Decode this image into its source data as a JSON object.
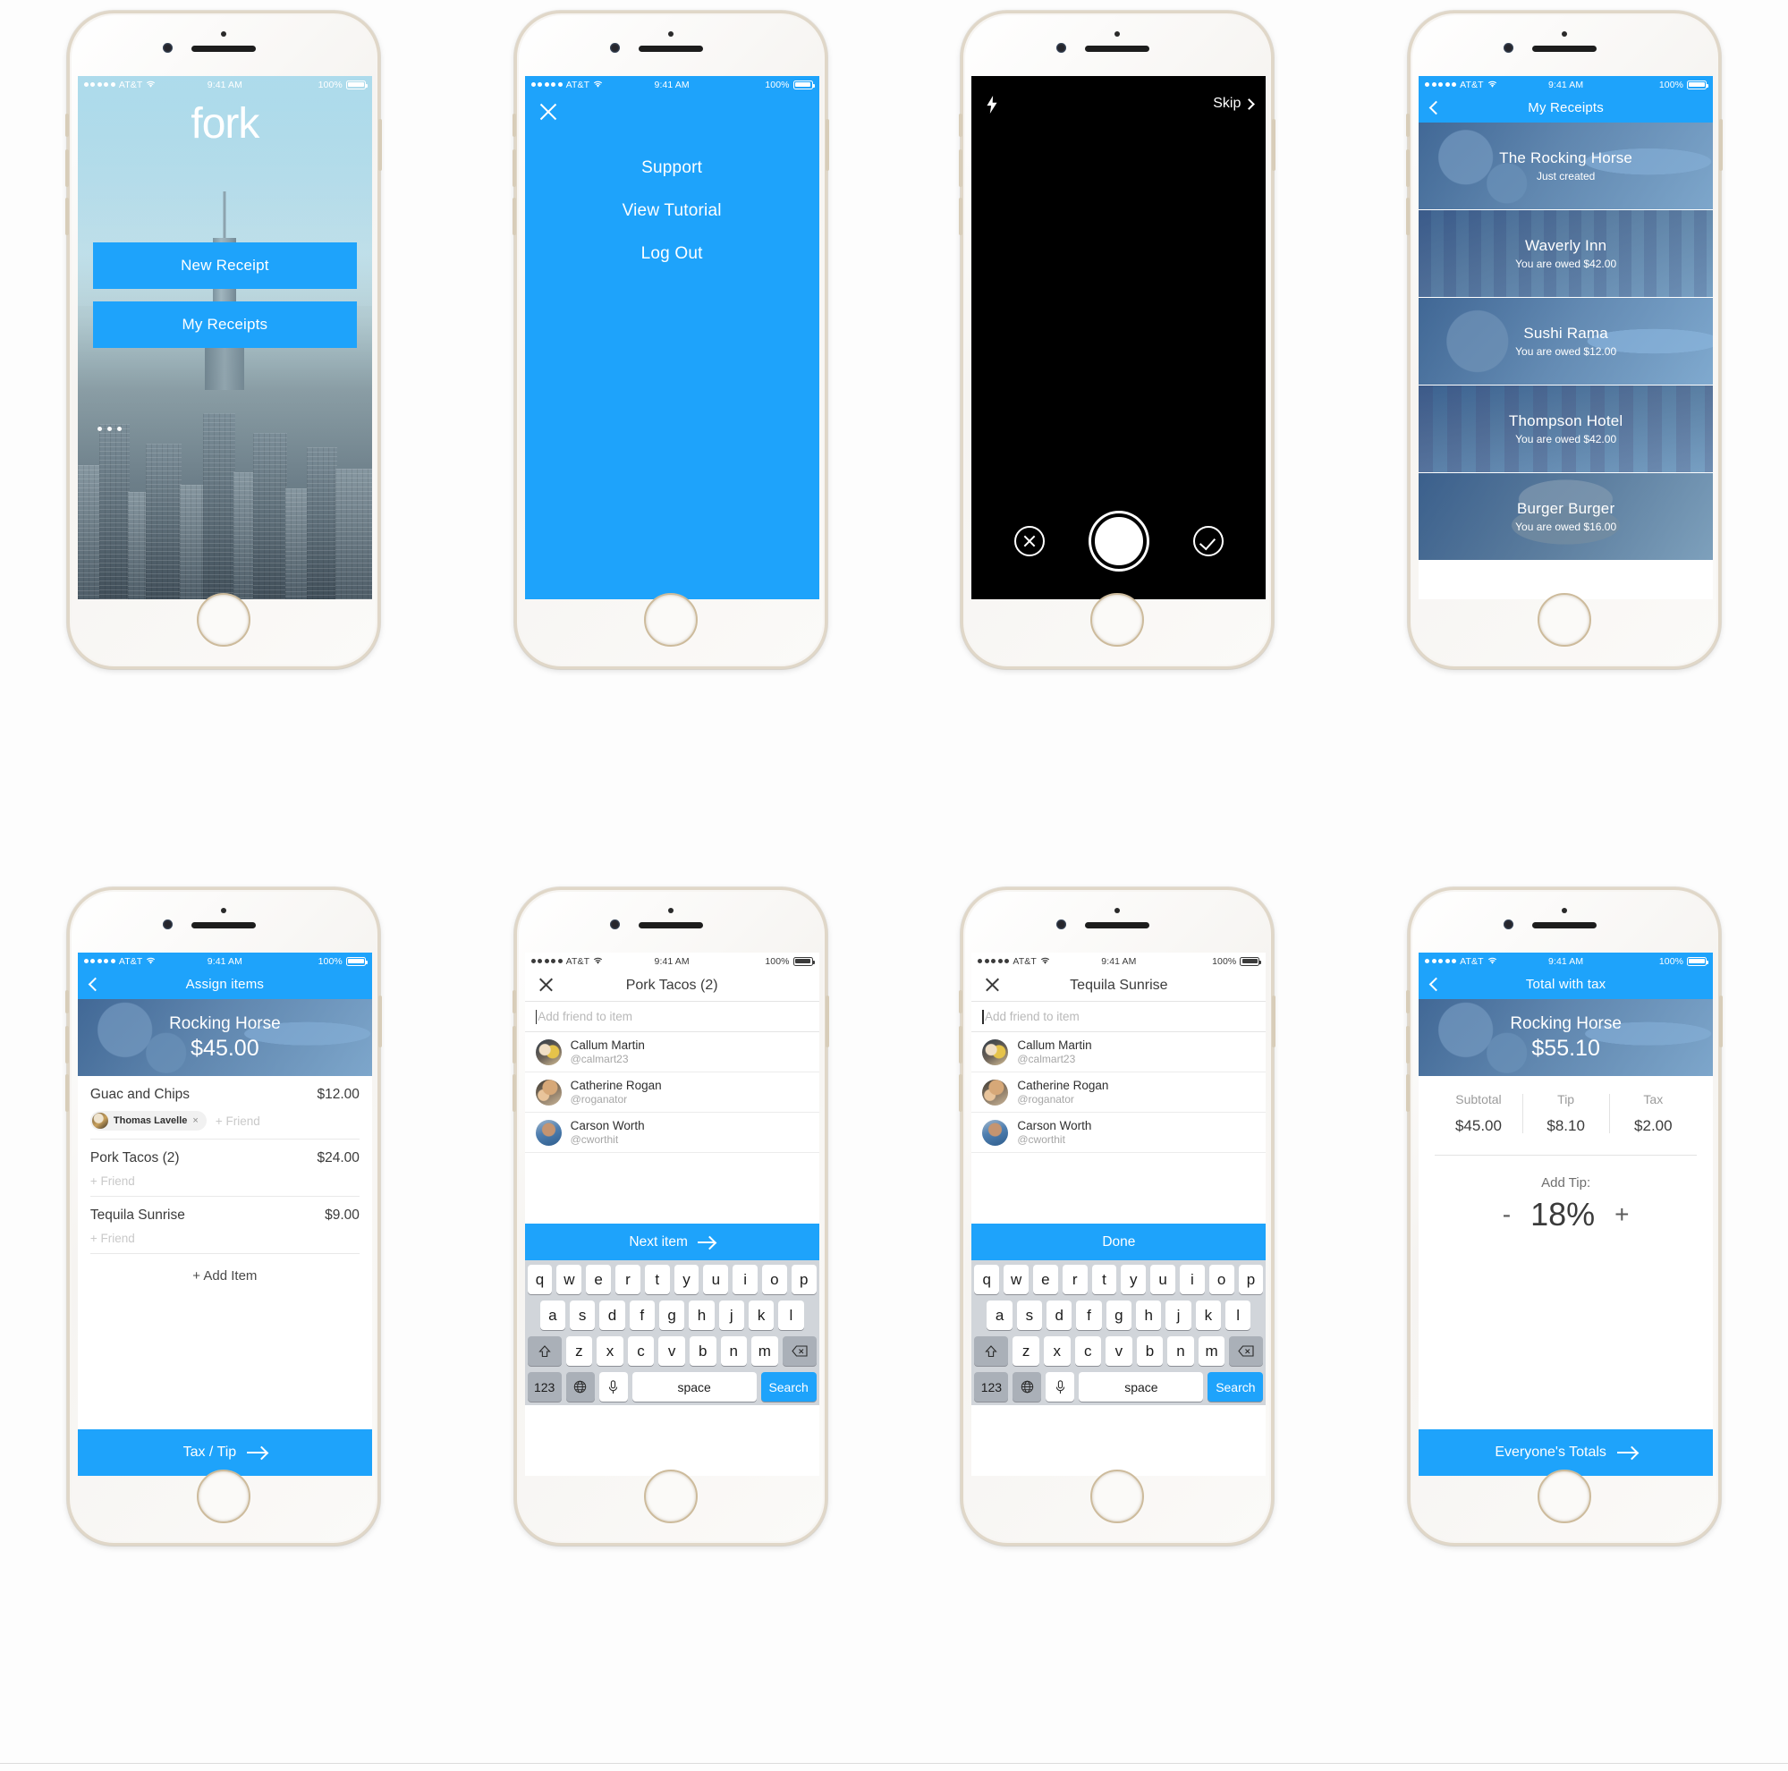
{
  "status_bar": {
    "carrier": "AT&T",
    "time": "9:41 AM",
    "battery": "100%"
  },
  "app": {
    "name": "fork"
  },
  "screens": {
    "splash": {
      "logo": "fork",
      "new_receipt_label": "New Receipt",
      "my_receipts_label": "My Receipts"
    },
    "menu": {
      "items": [
        {
          "label": "Support"
        },
        {
          "label": "View Tutorial"
        },
        {
          "label": "Log Out"
        }
      ]
    },
    "camera": {
      "skip_label": "Skip"
    },
    "receipts": {
      "title": "My Receipts",
      "rows": [
        {
          "name": "The Rocking Horse",
          "sub": "Just created"
        },
        {
          "name": "Waverly Inn",
          "sub": "You are owed $42.00"
        },
        {
          "name": "Sushi Rama",
          "sub": "You are owed $12.00"
        },
        {
          "name": "Thompson Hotel",
          "sub": "You are owed $42.00"
        },
        {
          "name": "Burger Burger",
          "sub": "You are owed $16.00"
        }
      ]
    },
    "assign": {
      "title": "Assign items",
      "hero_name": "Rocking Horse",
      "hero_amount": "$45.00",
      "items": [
        {
          "name": "Guac and Chips",
          "price": "$12.00",
          "friend": "Thomas Lavelle",
          "remove": "×",
          "add_friend": "+ Friend"
        },
        {
          "name": "Pork Tacos (2)",
          "price": "$24.00",
          "friend": "",
          "remove": "",
          "add_friend": "+ Friend"
        },
        {
          "name": "Tequila Sunrise",
          "price": "$9.00",
          "friend": "",
          "remove": "",
          "add_friend": "+ Friend"
        }
      ],
      "add_item_label": "+ Add Item",
      "cta_label": "Tax / Tip"
    },
    "add_friend_item": {
      "title": "Pork Tacos (2)",
      "search_placeholder": "Add friend to item",
      "friends": [
        {
          "name": "Callum Martin",
          "handle": "@calmart23"
        },
        {
          "name": "Catherine Rogan",
          "handle": "@roganator"
        },
        {
          "name": "Carson Worth",
          "handle": "@cworthit"
        }
      ],
      "cta_label": "Next item"
    },
    "add_friend_drink": {
      "title": "Tequila Sunrise",
      "search_placeholder": "Add friend to item",
      "friends": [
        {
          "name": "Callum Martin",
          "handle": "@calmart23"
        },
        {
          "name": "Catherine Rogan",
          "handle": "@roganator"
        },
        {
          "name": "Carson Worth",
          "handle": "@cworthit"
        }
      ],
      "cta_label": "Done"
    },
    "totals": {
      "title": "Total with tax",
      "hero_name": "Rocking Horse",
      "hero_amount": "$55.10",
      "columns": [
        {
          "label": "Subtotal",
          "value": "$45.00"
        },
        {
          "label": "Tip",
          "value": "$8.10"
        },
        {
          "label": "Tax",
          "value": "$2.00"
        }
      ],
      "tip_label": "Add Tip:",
      "tip_decrement": "-",
      "tip_value": "18%",
      "tip_increment": "+",
      "cta_label": "Everyone's Totals"
    }
  },
  "keyboard": {
    "row1": [
      "q",
      "w",
      "e",
      "r",
      "t",
      "y",
      "u",
      "i",
      "o",
      "p"
    ],
    "row2": [
      "a",
      "s",
      "d",
      "f",
      "g",
      "h",
      "j",
      "k",
      "l"
    ],
    "row3": [
      "z",
      "x",
      "c",
      "v",
      "b",
      "n",
      "m"
    ],
    "numbers_key": "123",
    "space_key": "space",
    "search_key": "Search"
  },
  "colors": {
    "accent": "#1EA3FB",
    "nav": "#1EA3FB",
    "keyboard_bg": "#d1d5da"
  }
}
